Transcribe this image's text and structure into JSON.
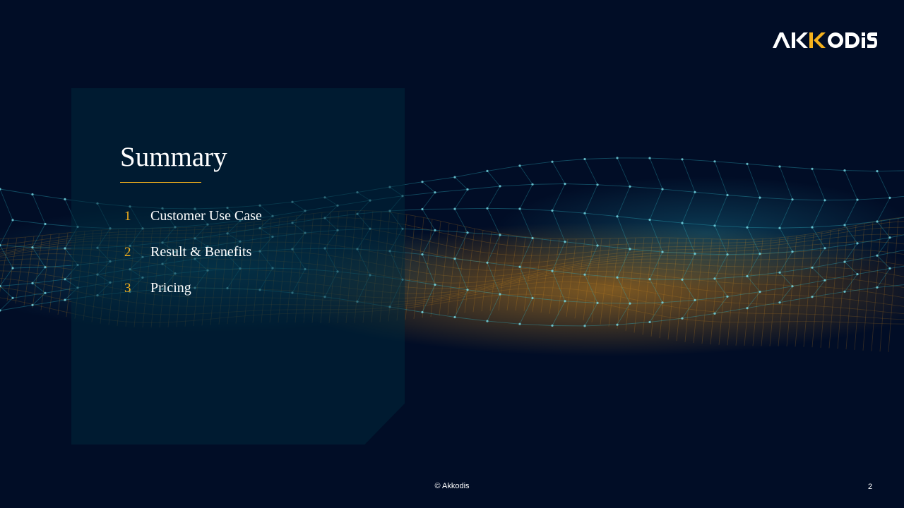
{
  "logo": {
    "text": "AKKODIS",
    "accent_color": "#f5b11c"
  },
  "summary": {
    "title": "Summary",
    "items": [
      {
        "number": "1",
        "label": "Customer Use Case"
      },
      {
        "number": "2",
        "label": "Result & Benefits"
      },
      {
        "number": "3",
        "label": "Pricing"
      }
    ]
  },
  "footer": {
    "copyright": "© Akkodis",
    "page_number": "2"
  },
  "colors": {
    "background": "#010d26",
    "accent": "#f5b11c",
    "mesh_cyan": "#2fb8c9",
    "mesh_orange": "#e3961f"
  }
}
